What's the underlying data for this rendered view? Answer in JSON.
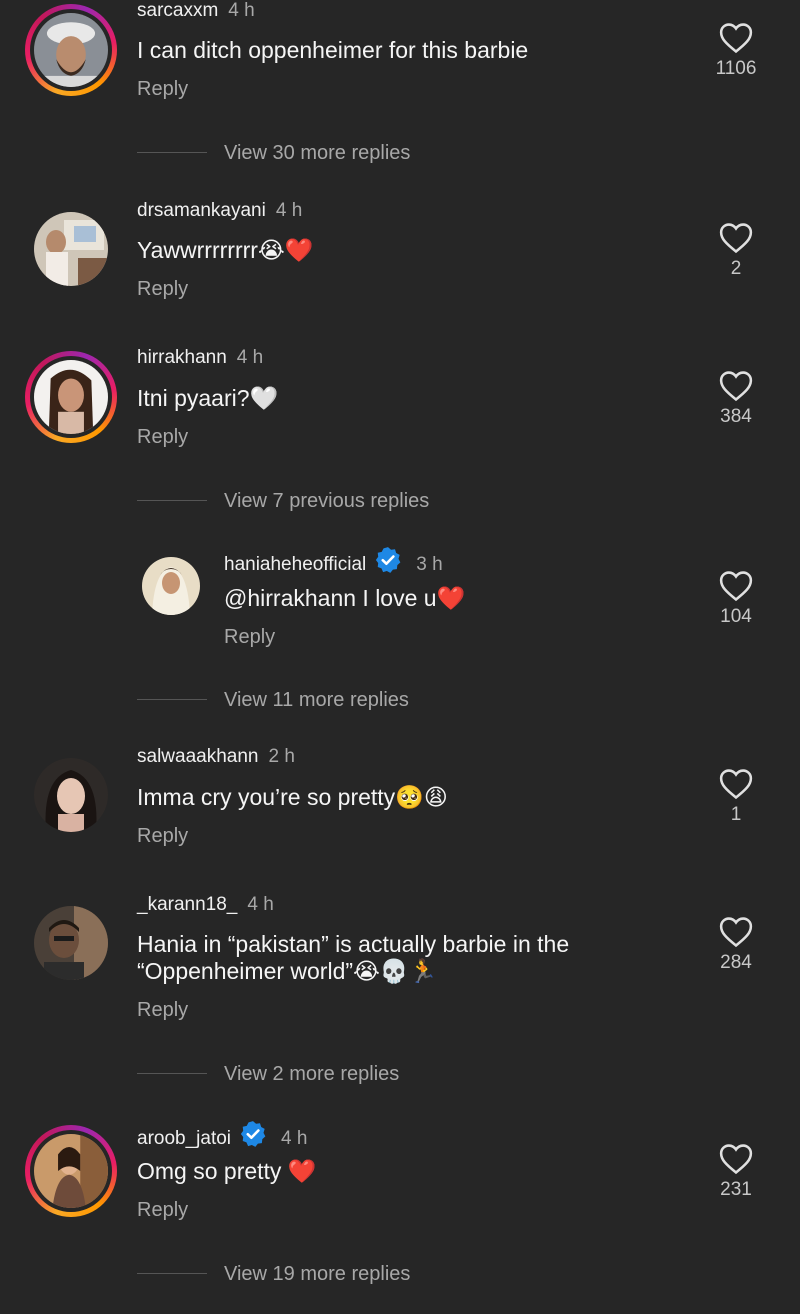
{
  "colors": {
    "background": "#262626",
    "muted": "#a8a8a8",
    "heart_red": "#e53935",
    "verified_blue": "#1e88e5"
  },
  "comments": [
    {
      "username": "sarcaxxm",
      "time": "4 h",
      "text": "I can ditch oppenheimer for this barbie",
      "reply": "Reply",
      "likes": "1106",
      "view_more": "View 30 more replies"
    },
    {
      "username": "drsamankayani",
      "time": "4 h",
      "text": "Yawwrrrrrrrr😭❤️",
      "reply": "Reply",
      "likes": "2"
    },
    {
      "username": "hirrakhann",
      "time": "4 h",
      "text": "Itni pyaari?🤍",
      "reply": "Reply",
      "likes": "384",
      "view_more": "View 7 previous replies"
    },
    {
      "username": "haniaheheofficial",
      "time": "3 h",
      "text": "@hirrakhann I love u❤️",
      "reply": "Reply",
      "likes": "104",
      "view_more": "View 11 more replies"
    },
    {
      "username": "salwaaakhann",
      "time": "2 h",
      "text": "Imma cry you’re so pretty🥺😩",
      "reply": "Reply",
      "likes": "1"
    },
    {
      "username": "_karann18_",
      "time": "4 h",
      "text_line1": "Hania in “pakistan” is actually barbie in the",
      "text_line2": "“Oppenheimer world”😭💀🏃",
      "reply": "Reply",
      "likes": "284",
      "view_more": "View 2 more replies"
    },
    {
      "username": "aroob_jatoi",
      "time": "4 h",
      "text": "Omg so pretty ❤️",
      "reply": "Reply",
      "likes": "231",
      "view_more": "View 19 more replies"
    }
  ]
}
